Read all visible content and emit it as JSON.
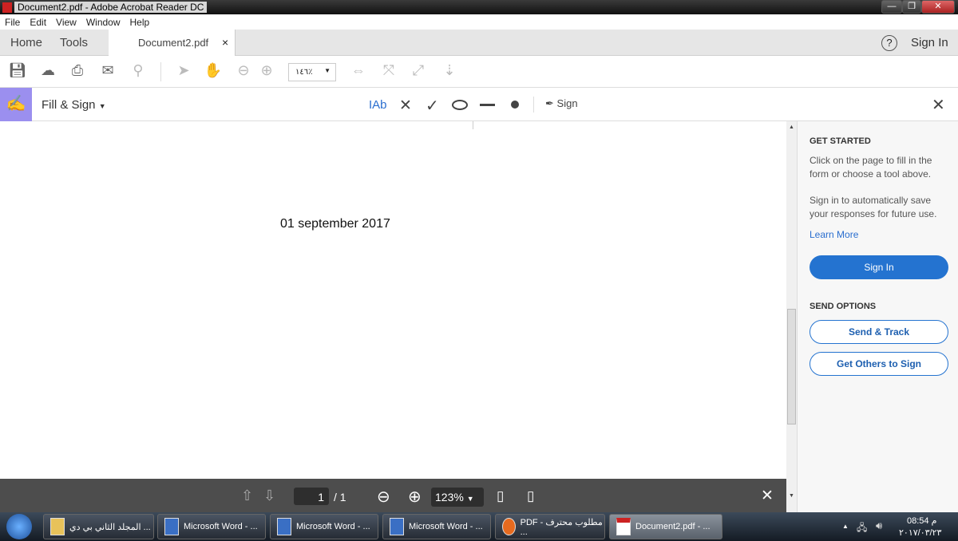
{
  "window": {
    "title": "Document2.pdf - Adobe Acrobat Reader DC",
    "minimize": "—",
    "maximize": "❐",
    "close": "✕"
  },
  "menu": [
    "File",
    "Edit",
    "View",
    "Window",
    "Help"
  ],
  "tabs": {
    "home": "Home",
    "tools": "Tools",
    "document": "Document2.pdf",
    "close": "×",
    "help": "?",
    "sign_in": "Sign In"
  },
  "toolbar": {
    "zoom_value": "١٤٦٪"
  },
  "fill_sign": {
    "title": "Fill & Sign",
    "text_tool": "Ab",
    "cross": "✕",
    "check": "✓",
    "sign": "Sign",
    "close": "✕"
  },
  "document": {
    "text": "01 september 2017"
  },
  "pane": {
    "get_started": "GET STARTED",
    "text1": "Click on the page to fill in the form or choose a tool above.",
    "text2": "Sign in to automatically save your responses for future use.",
    "learn_more": "Learn More",
    "sign_in": "Sign In",
    "send_options": "SEND OPTIONS",
    "send_track": "Send & Track",
    "get_others": "Get Others to Sign"
  },
  "floatbar": {
    "page": "1",
    "total": "/ 1",
    "zoom": "123%"
  },
  "taskbar": {
    "items": [
      "المجلد الثاني بي دي ...",
      "Microsoft Word - ...",
      "Microsoft Word - ...",
      "Microsoft Word - ...",
      "PDF - مطلوب محترف ...",
      "Document2.pdf - ..."
    ],
    "time": "08:54 م",
    "date": "٢٠١٧/٠٣/٢٣"
  }
}
